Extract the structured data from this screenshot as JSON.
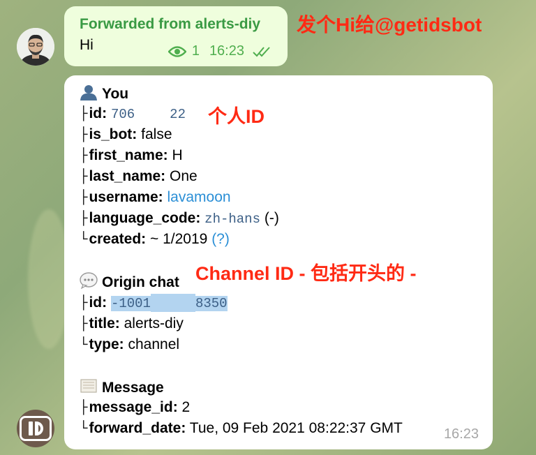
{
  "forwarded": {
    "header": "Forwarded from alerts-diy",
    "text": "Hi",
    "views": "1",
    "time": "16:23"
  },
  "annotations": {
    "send_hi": "发个Hi给@getidsbot",
    "personal_id": "个人ID",
    "channel_id": "Channel ID - 包括开头的 -"
  },
  "response": {
    "you": {
      "title": "You",
      "icon": "user-silhouette-icon",
      "id_label": "id:",
      "id_a": "706",
      "id_b": "22",
      "is_bot_label": "is_bot:",
      "is_bot": "false",
      "first_name_label": "first_name:",
      "first_name": "H",
      "last_name_label": "last_name:",
      "last_name": "One",
      "username_label": "username:",
      "username": "lavamoon",
      "language_code_label": "language_code:",
      "language_code": "zh-hans",
      "language_suffix": "(-)",
      "created_label": "created:",
      "created": "~ 1/2019",
      "created_help": "(?)"
    },
    "origin_chat": {
      "title": "Origin chat",
      "icon": "speech-bubble-icon",
      "id_label": "id:",
      "id_a": "-1001",
      "id_b": "8350",
      "title_label": "title:",
      "title_value": "alerts-diy",
      "type_label": "type:",
      "type_value": "channel"
    },
    "message": {
      "title": "Message",
      "icon": "scroll-icon",
      "message_id_label": "message_id:",
      "message_id": "2",
      "forward_date_label": "forward_date:",
      "forward_date": "Tue, 09 Feb 2021 08:22:37 GMT"
    },
    "time": "16:23"
  },
  "colors": {
    "annotation": "#ff2a14",
    "link": "#2b8fd6",
    "forward_header": "#3a9a44",
    "highlight": "#b3d4f0"
  }
}
